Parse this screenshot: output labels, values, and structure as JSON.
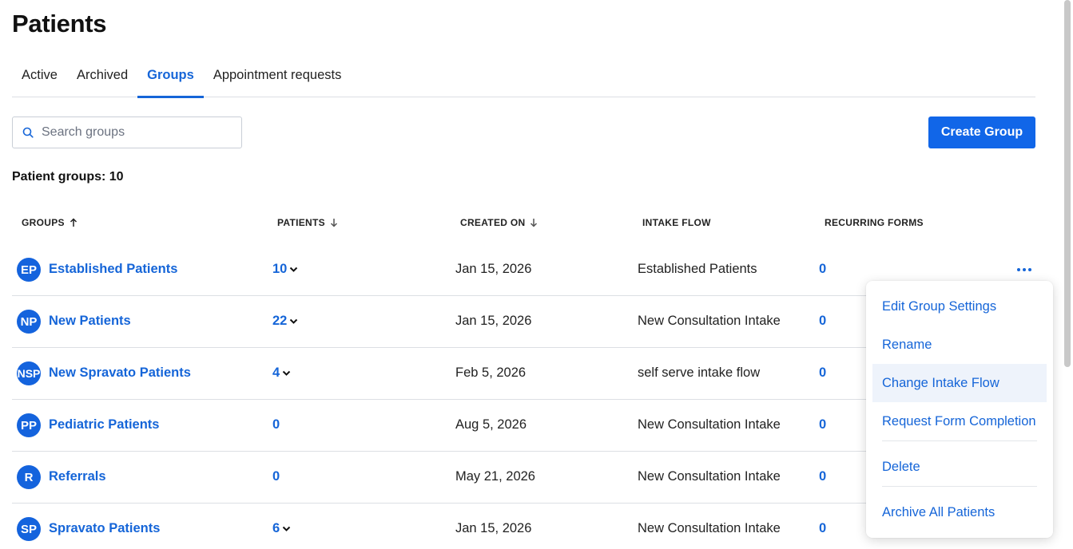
{
  "page": {
    "title": "Patients"
  },
  "tabs": [
    {
      "label": "Active",
      "active": false
    },
    {
      "label": "Archived",
      "active": false
    },
    {
      "label": "Groups",
      "active": true
    },
    {
      "label": "Appointment requests",
      "active": false
    }
  ],
  "search": {
    "placeholder": "Search groups",
    "value": ""
  },
  "create_button": {
    "label": "Create Group"
  },
  "summary": {
    "text": "Patient groups: 10"
  },
  "columns": {
    "groups": "GROUPS",
    "patients": "PATIENTS",
    "created_on": "CREATED ON",
    "intake_flow": "INTAKE FLOW",
    "recurring_forms": "RECURRING FORMS"
  },
  "rows": [
    {
      "initials": "EP",
      "name": "Established Patients",
      "patients": "10",
      "created": "Jan 15, 2026",
      "intake": "Established Patients",
      "recurring": "0"
    },
    {
      "initials": "NP",
      "name": "New Patients",
      "patients": "22",
      "created": "Jan 15, 2026",
      "intake": "New Consultation Intake",
      "recurring": "0"
    },
    {
      "initials": "NSP",
      "name": "New Spravato Patients",
      "patients": "4",
      "created": "Feb 5, 2026",
      "intake": "self serve intake flow",
      "recurring": "0"
    },
    {
      "initials": "PP",
      "name": "Pediatric Patients",
      "patients": "0",
      "created": "Aug 5, 2026",
      "intake": "New Consultation Intake",
      "recurring": "0"
    },
    {
      "initials": "R",
      "name": "Referrals",
      "patients": "0",
      "created": "May 21, 2026",
      "intake": "New Consultation Intake",
      "recurring": "0"
    },
    {
      "initials": "SP",
      "name": "Spravato Patients",
      "patients": "6",
      "created": "Jan 15, 2026",
      "intake": "New Consultation Intake",
      "recurring": "0"
    }
  ],
  "menu": {
    "items": [
      {
        "label": "Edit Group Settings"
      },
      {
        "label": "Rename"
      },
      {
        "label": "Change Intake Flow",
        "hovered": true
      },
      {
        "label": "Request Form Completion"
      },
      {
        "label": "Delete"
      },
      {
        "label": "Archive All Patients"
      }
    ]
  },
  "colors": {
    "accent": "#1565d8",
    "button": "#1166e8",
    "avatar": "#1463dd",
    "border": "#dcdfe4"
  },
  "icons": {
    "search": "search-icon",
    "sort_asc": "arrow-up-icon",
    "sort_desc": "arrow-down-icon",
    "expand": "chevron-down-icon",
    "more": "more-horizontal-icon"
  }
}
